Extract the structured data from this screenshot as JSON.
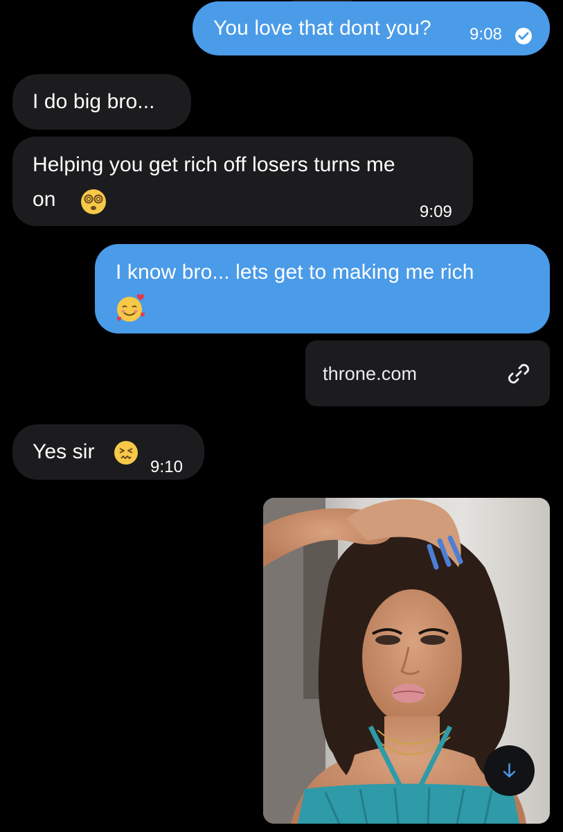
{
  "messages": [
    {
      "id": "m1",
      "direction": "outgoing",
      "text": "You love that dont you?",
      "time": "9:08",
      "status": "read-check"
    },
    {
      "id": "m2",
      "direction": "incoming",
      "text": "I do big bro..."
    },
    {
      "id": "m3",
      "direction": "incoming",
      "line1": "Helping you get rich off losers turns me",
      "line2": "on",
      "emoji": "dizzy-face",
      "time": "9:09"
    },
    {
      "id": "m4",
      "direction": "outgoing",
      "line1": "I know bro... lets get to making me rich",
      "emoji": "smiling-face-with-hearts"
    },
    {
      "id": "m5",
      "direction": "incoming",
      "text": "Yes sir",
      "emoji": "confounded-face",
      "time": "9:10"
    }
  ],
  "link_card": {
    "domain": "throne.com",
    "icon": "link-icon"
  },
  "photo": {
    "description_icon": "photo-attachment",
    "download_icon": "arrow-down-icon"
  },
  "colors": {
    "outgoing_bubble": "#4a9be8",
    "incoming_bubble": "#1c1c1e",
    "background": "#000000",
    "download_arrow": "#4a9be8"
  }
}
